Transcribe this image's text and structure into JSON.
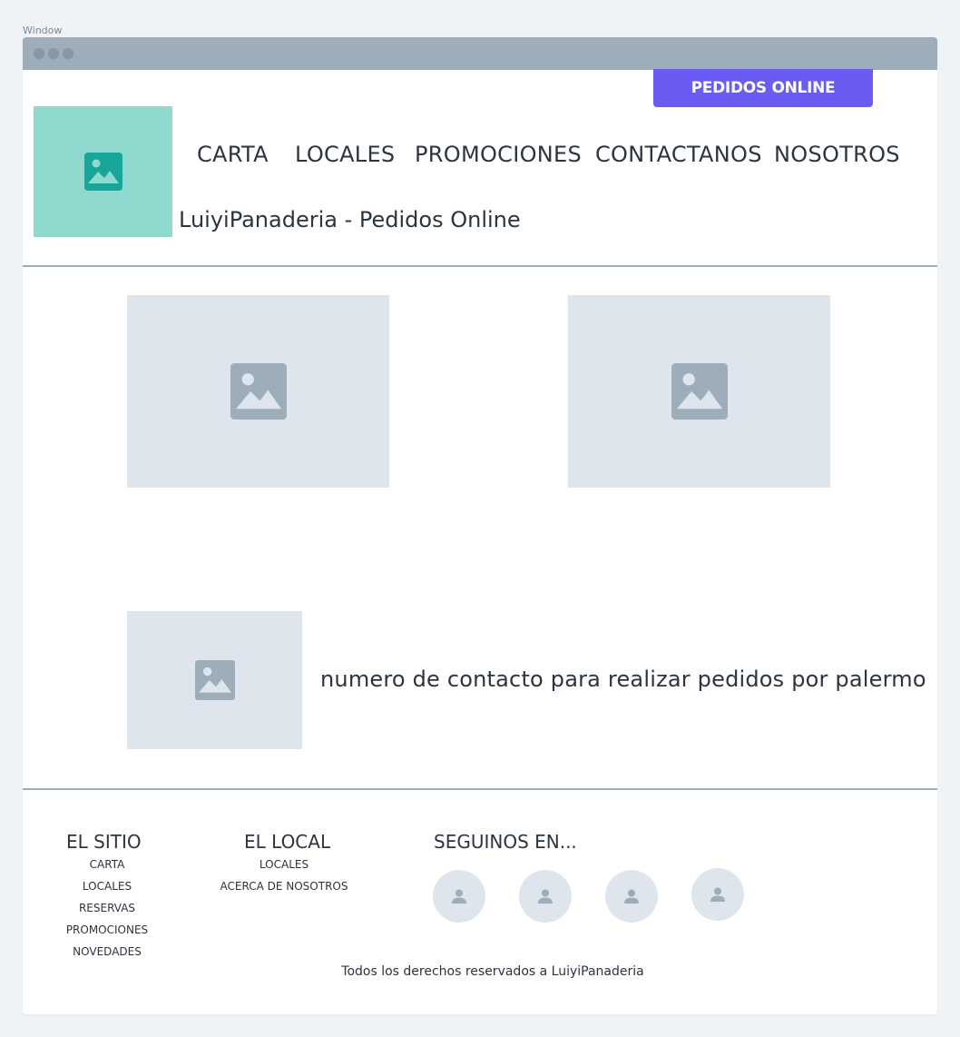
{
  "window": {
    "label": "Window"
  },
  "header": {
    "cta_label": "PEDIDOS ONLINE",
    "site_title": "LuiyiPanaderia - Pedidos Online",
    "nav": [
      {
        "label": "CARTA"
      },
      {
        "label": "LOCALES"
      },
      {
        "label": "PROMOCIONES"
      },
      {
        "label": "CONTACTANOS"
      },
      {
        "label": "NOSOTROS"
      }
    ]
  },
  "main": {
    "contact_text": "numero de contacto para realizar pedidos por palermo"
  },
  "footer": {
    "sitio": {
      "title": "EL SITIO",
      "links": [
        "CARTA",
        "LOCALES",
        "RESERVAS",
        "PROMOCIONES",
        "NOVEDADES"
      ]
    },
    "local": {
      "title": "EL LOCAL",
      "links": [
        "LOCALES",
        "ACERCA DE NOSOTROS"
      ]
    },
    "social": {
      "title": "SEGUINOS EN..."
    },
    "copyright": "Todos los derechos reservados a LuiyiPanaderia"
  },
  "colors": {
    "accent": "#6a5cf2",
    "logo_bg": "#8fd9cf",
    "logo_icon": "#17a697",
    "placeholder_bg": "#dfe5ed",
    "placeholder_icon": "#9eadba",
    "divider": "#9eadba"
  }
}
